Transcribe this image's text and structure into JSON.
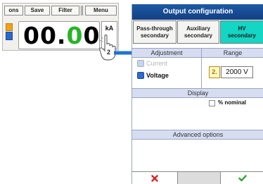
{
  "toolbar": {
    "tab1": "ons",
    "save": "Save",
    "filter": "Filter",
    "menu": "Menu"
  },
  "display": {
    "reading_prefix": "00.",
    "reading_green": "0",
    "reading_suffix": "0",
    "unit": "kA"
  },
  "step_badge": "2",
  "config": {
    "title": "Output configuration",
    "tabs": [
      {
        "label_line1": "Pass-through",
        "label_line2": "secondary",
        "active": false
      },
      {
        "label_line1": "Auxiliary",
        "label_line2": "secondary",
        "active": false
      },
      {
        "label_line1": "HV",
        "label_line2": "secondary",
        "active": true
      }
    ],
    "adjustment_header": "Adjustment",
    "range_header": "Range",
    "options": [
      {
        "label": "Current",
        "selected": false,
        "enabled": false
      },
      {
        "label": "Voltage",
        "selected": true,
        "enabled": true
      }
    ],
    "range_key": "2.",
    "range_value": "2000 V",
    "display_header": "Display",
    "nominal_label": "% nominal",
    "nominal_checked": false,
    "advanced_header": "Advanced options",
    "cancel_icon": "red-x-icon",
    "ok_icon": "green-check-icon"
  },
  "colors": {
    "title_bar": "#1c5aa6",
    "active_tab": "#13d6c4",
    "section_header": "#d6ddf1",
    "arrow": "#1e73d8",
    "reading_green": "#26b426",
    "cancel": "#e02020",
    "ok": "#2ea82e"
  }
}
